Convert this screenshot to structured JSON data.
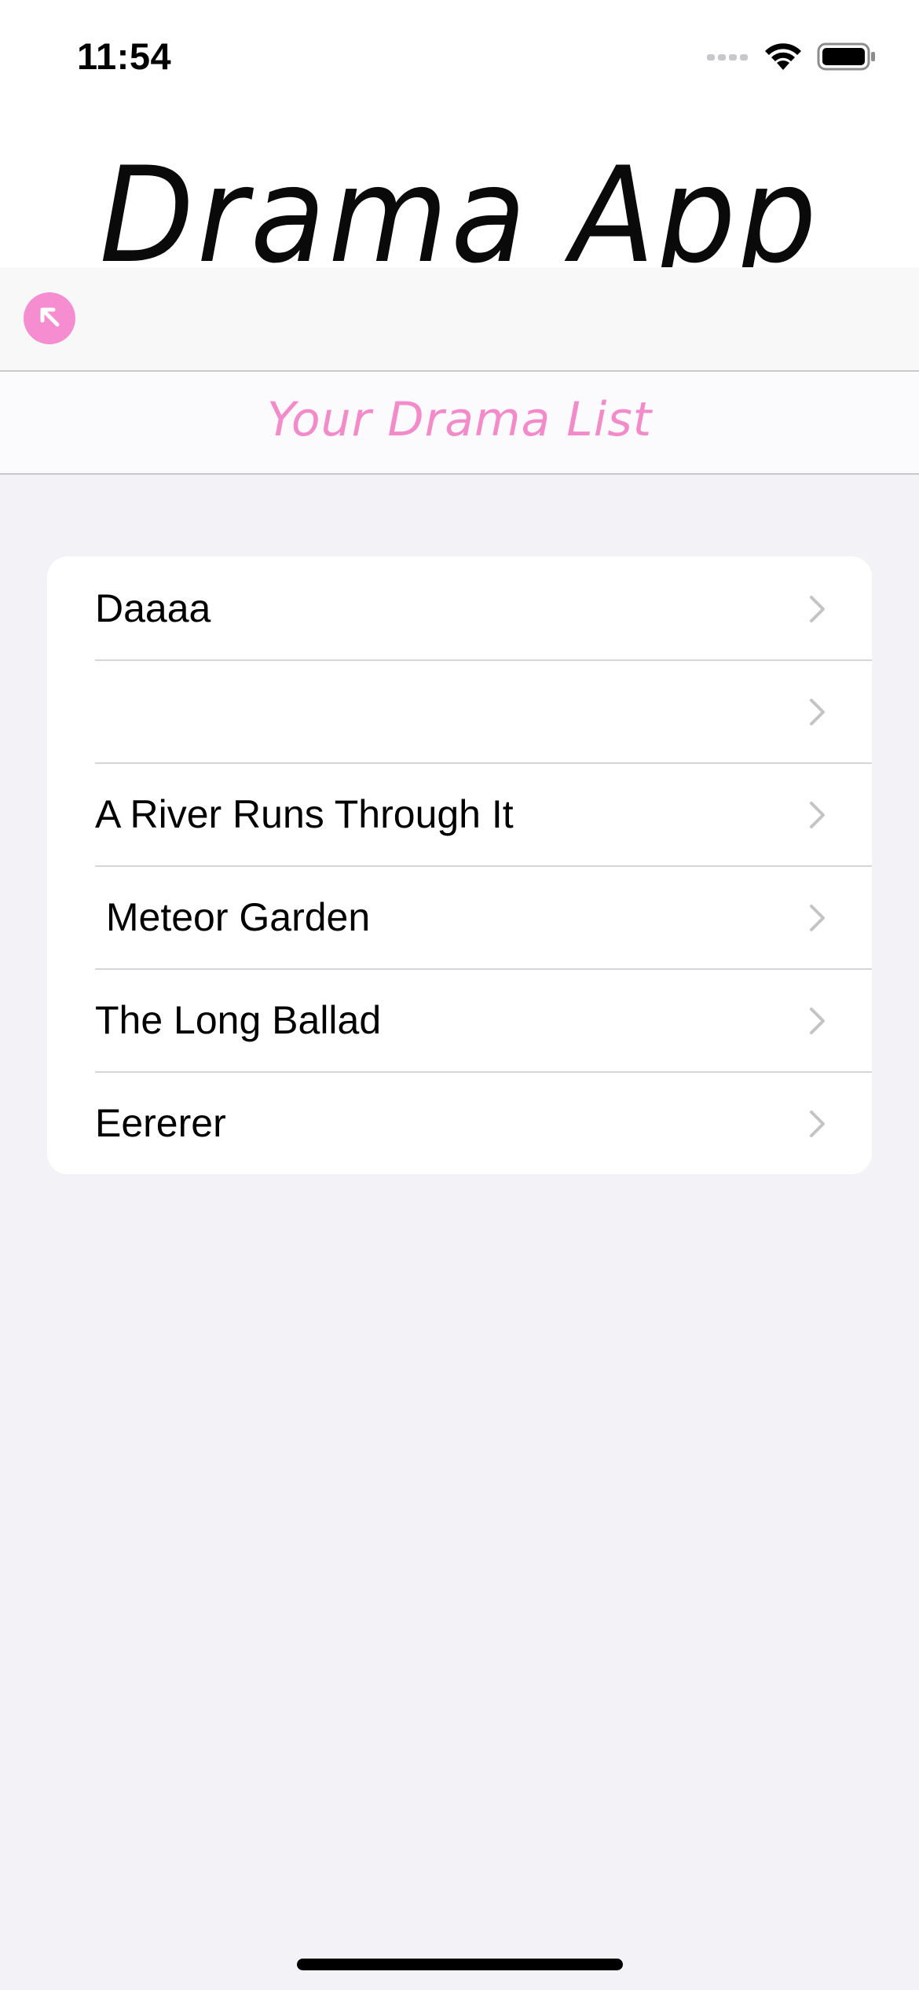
{
  "status_bar": {
    "time": "11:54",
    "icons": [
      "signal-icon",
      "wifi-icon",
      "battery-icon"
    ]
  },
  "header": {
    "logo_text": "Drama App"
  },
  "nav": {
    "back_icon": "arrow-up-left-icon"
  },
  "page": {
    "title": "Your Drama List"
  },
  "dramas": [
    {
      "title": "Daaaa"
    },
    {
      "title": ""
    },
    {
      "title": "A River Runs Through It"
    },
    {
      "title": " Meteor Garden"
    },
    {
      "title": "The Long Ballad"
    },
    {
      "title": "Eererer"
    }
  ],
  "colors": {
    "accent": "#f68dd1",
    "title_pink": "#f38ac9",
    "background": "#f2f2f7",
    "chevron": "#c4c4c7"
  }
}
